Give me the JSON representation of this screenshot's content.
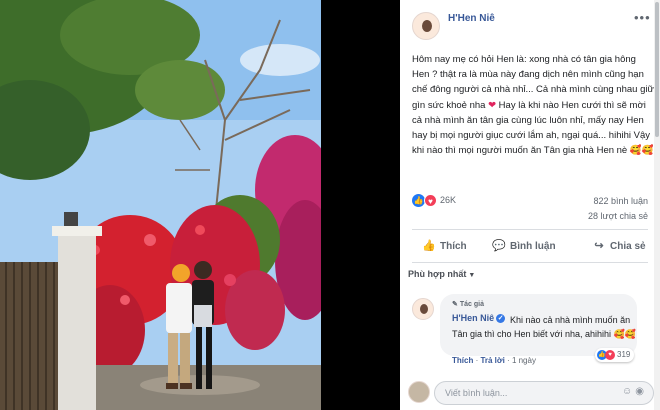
{
  "post": {
    "author": "H'Hen Niê",
    "more_icon": "more-horizontal-icon",
    "text_main": "Hôm nay mẹ có hỏi Hen là: xong nhà có tân gia hông Hen ? thật ra là mùa này đang dịch nên mình cũng hạn chế đông người cả nhà nhỉ... Cả nhà mình cùng nhau giữ gìn sức khoẻ nha",
    "text_heart": "❤",
    "text_after": " Hay là khi nào Hen cưới thì sẽ mời cả nhà mình ăn tân gia cùng lúc luôn nhỉ, mấy nay Hen hay bị mọi người giục cưới lắm ah, ngại quá... hihihi Vậy khi nào thì mọi người muốn ăn Tân gia nhà Hen nè",
    "text_emoji": "🥰🥰"
  },
  "stats": {
    "reactions": "26K",
    "comments": "822 bình luận",
    "shares": "28 lượt chia sẻ"
  },
  "actions": {
    "like": "Thích",
    "comment": "Bình luận",
    "share": "Chia sẻ"
  },
  "sort_label": "Phù hợp nhất",
  "comment": {
    "badge": "Tác giả",
    "author": "H'Hen Niê",
    "text": "Khi nào cả nhà mình muốn ăn Tân gia thì cho Hen biết với nha, ahihihi 🥰🥰",
    "like": "Thích",
    "reply": "Trả lời",
    "time": "1 ngày",
    "reaction_count": "319"
  },
  "composer": {
    "placeholder": "Viết bình luận..."
  },
  "colors": {
    "link_blue": "#385898",
    "like_blue": "#2078f4",
    "love_red": "#f33e58"
  }
}
